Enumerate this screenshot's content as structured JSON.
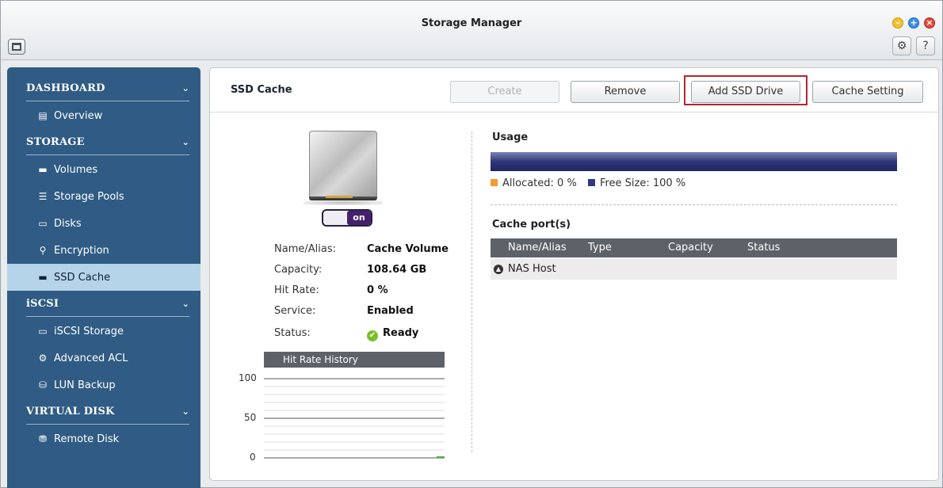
{
  "window": {
    "title": "Storage Manager",
    "controls": [
      "minimize-icon",
      "maximize-icon",
      "close-icon"
    ],
    "toolbar_icons": [
      "gear-icon",
      "help-icon"
    ]
  },
  "sidebar": {
    "sections": [
      {
        "label": "DASHBOARD",
        "items": [
          {
            "label": "Overview",
            "icon": "overview-icon"
          }
        ]
      },
      {
        "label": "STORAGE",
        "items": [
          {
            "label": "Volumes",
            "icon": "volume-icon"
          },
          {
            "label": "Storage Pools",
            "icon": "storage-pool-icon"
          },
          {
            "label": "Disks",
            "icon": "disk-icon"
          },
          {
            "label": "Encryption",
            "icon": "key-icon"
          },
          {
            "label": "SSD Cache",
            "icon": "ssd-icon",
            "active": true
          }
        ]
      },
      {
        "label": "iSCSI",
        "items": [
          {
            "label": "iSCSI Storage",
            "icon": "iscsi-storage-icon"
          },
          {
            "label": "Advanced ACL",
            "icon": "acl-gear-icon"
          },
          {
            "label": "LUN Backup",
            "icon": "lun-backup-icon"
          }
        ]
      },
      {
        "label": "VIRTUAL DISK",
        "items": [
          {
            "label": "Remote Disk",
            "icon": "remote-disk-icon"
          }
        ]
      }
    ]
  },
  "main": {
    "title": "SSD Cache",
    "buttons": {
      "create": "Create",
      "remove": "Remove",
      "add_ssd": "Add SSD Drive",
      "cache_setting": "Cache Setting"
    },
    "toggle_label": "on",
    "info": [
      {
        "label": "Name/Alias:",
        "value": "Cache Volume"
      },
      {
        "label": "Capacity:",
        "value": "108.64 GB"
      },
      {
        "label": "Hit Rate:",
        "value": "0 %"
      },
      {
        "label": "Service:",
        "value": "Enabled"
      },
      {
        "label": "Status:",
        "value": "Ready"
      }
    ],
    "hit_rate": {
      "title": "Hit Rate History",
      "y_ticks": [
        "100",
        "50",
        "0"
      ]
    },
    "usage": {
      "title": "Usage",
      "allocated_text": "Allocated: 0 %",
      "free_text": "Free Size: 100 %",
      "allocated_pct": 0,
      "colors": {
        "allocated": "#f09c2d",
        "free": "#2f3a84"
      }
    },
    "cache_ports": {
      "title": "Cache port(s)",
      "columns": [
        "Name/Alias",
        "Type",
        "Capacity",
        "Status"
      ],
      "rows": [
        {
          "name": "NAS Host"
        }
      ]
    }
  }
}
